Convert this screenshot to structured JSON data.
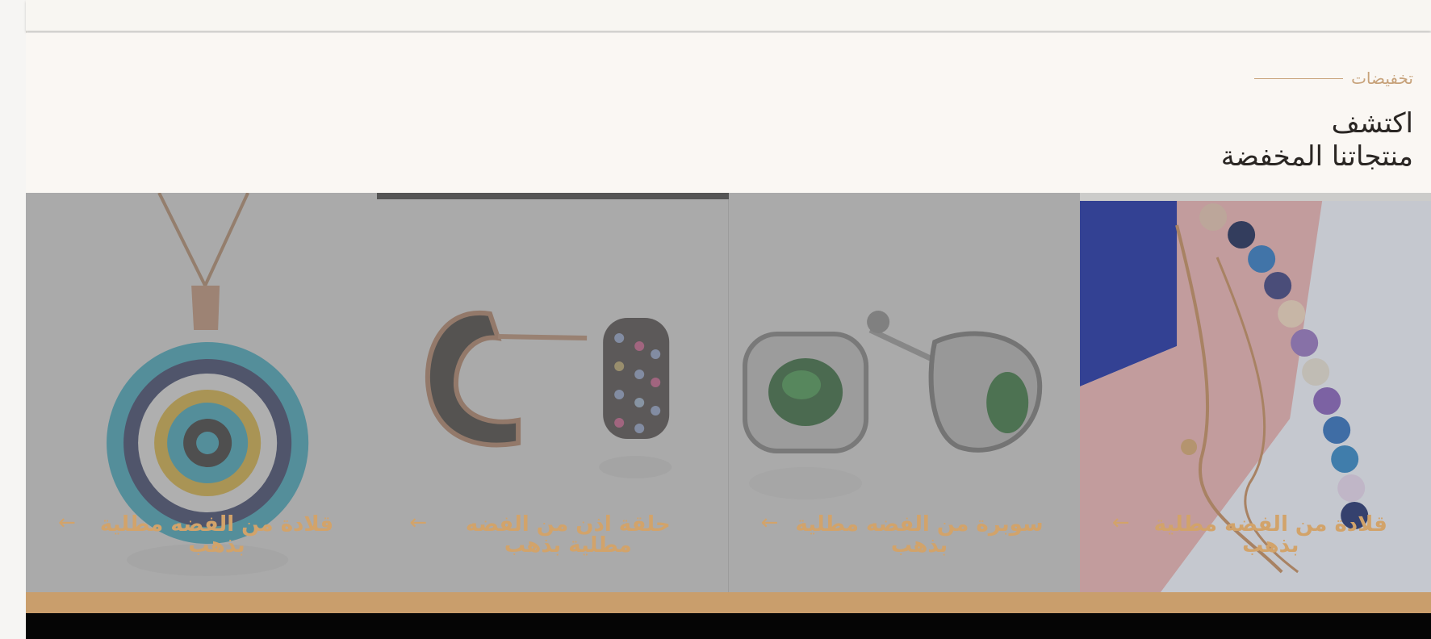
{
  "section": {
    "eyebrow": "تخفيضات",
    "heading_line1": "اكتشف",
    "heading_line2": "منتجاتنا المخفضة"
  },
  "products": [
    {
      "title": "قلادة من الفضه مطلية بذهب",
      "arrow": "←"
    },
    {
      "title": "سوبرة من الفضه مطلية بذهب",
      "arrow": "←"
    },
    {
      "title": "حلقة اذن من الفضه مطلية بذهب",
      "arrow": "←"
    },
    {
      "title": "قلادة من الفضه مطلية بذهب",
      "arrow": "←"
    }
  ],
  "icons": {
    "arrow": "arrow-left-icon"
  },
  "colors": {
    "accent": "#c99e6c",
    "title": "#d2a36a",
    "eyebrow": "#c7a27a",
    "footer": "#050505"
  }
}
